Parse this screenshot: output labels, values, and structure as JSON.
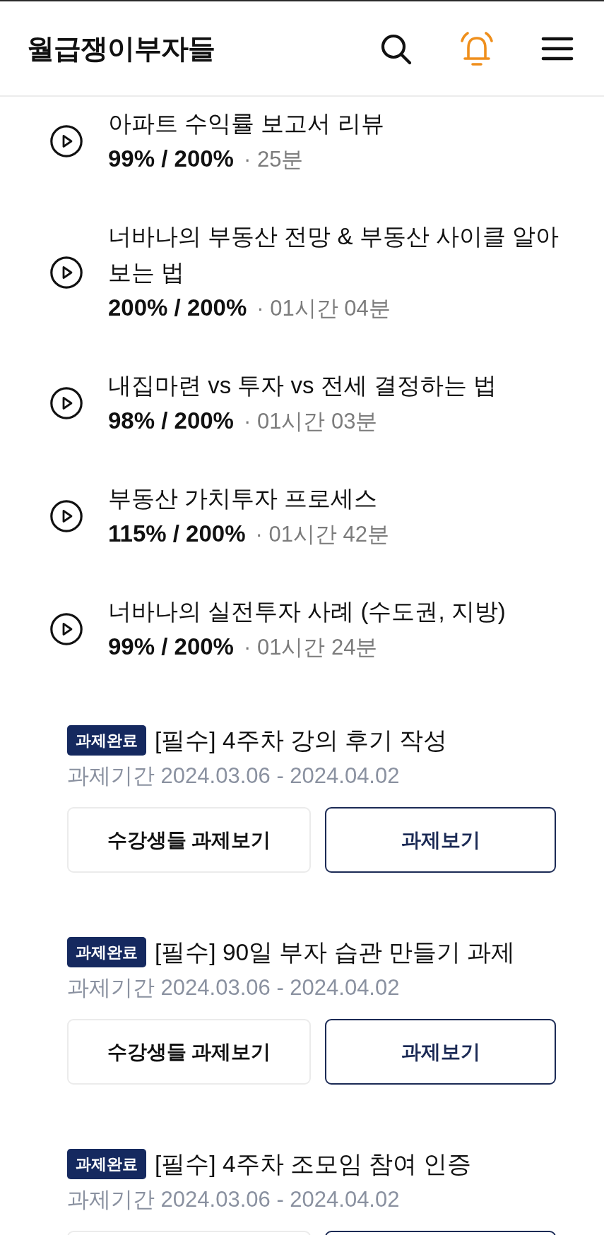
{
  "header": {
    "logo": "월급쟁이부자들"
  },
  "lectures": [
    {
      "title": "아파트 수익률 보고서 리뷰",
      "progress": "99% / 200%",
      "duration": "· 25분"
    },
    {
      "title": "너바나의 부동산 전망 & 부동산 사이클 알아보는 법",
      "progress": "200% / 200%",
      "duration": "· 01시간 04분"
    },
    {
      "title": "내집마련 vs 투자 vs 전세 결정하는 법",
      "progress": "98% / 200%",
      "duration": "· 01시간 03분"
    },
    {
      "title": "부동산 가치투자 프로세스",
      "progress": "115% / 200%",
      "duration": "· 01시간 42분"
    },
    {
      "title": "너바나의 실전투자 사례 (수도권, 지방)",
      "progress": "99% / 200%",
      "duration": "· 01시간 24분"
    }
  ],
  "tasks": [
    {
      "status": "과제완료",
      "title": "[필수] 4주차 강의 후기 작성",
      "period": "과제기간 2024.03.06 - 2024.04.02",
      "buttons": [
        {
          "label": "수강생들 과제보기",
          "kind": "secondary"
        },
        {
          "label": "과제보기",
          "kind": "primary"
        }
      ]
    },
    {
      "status": "과제완료",
      "title": "[필수] 90일 부자 습관 만들기 과제",
      "period": "과제기간 2024.03.06 - 2024.04.02",
      "buttons": [
        {
          "label": "수강생들 과제보기",
          "kind": "secondary"
        },
        {
          "label": "과제보기",
          "kind": "primary"
        }
      ]
    },
    {
      "status": "과제완료",
      "title": "[필수] 4주차 조모임 참여 인증",
      "period": "과제기간 2024.03.06 - 2024.04.02",
      "buttons": [
        {
          "kind": "secondary"
        },
        {
          "kind": "primary"
        }
      ]
    }
  ]
}
